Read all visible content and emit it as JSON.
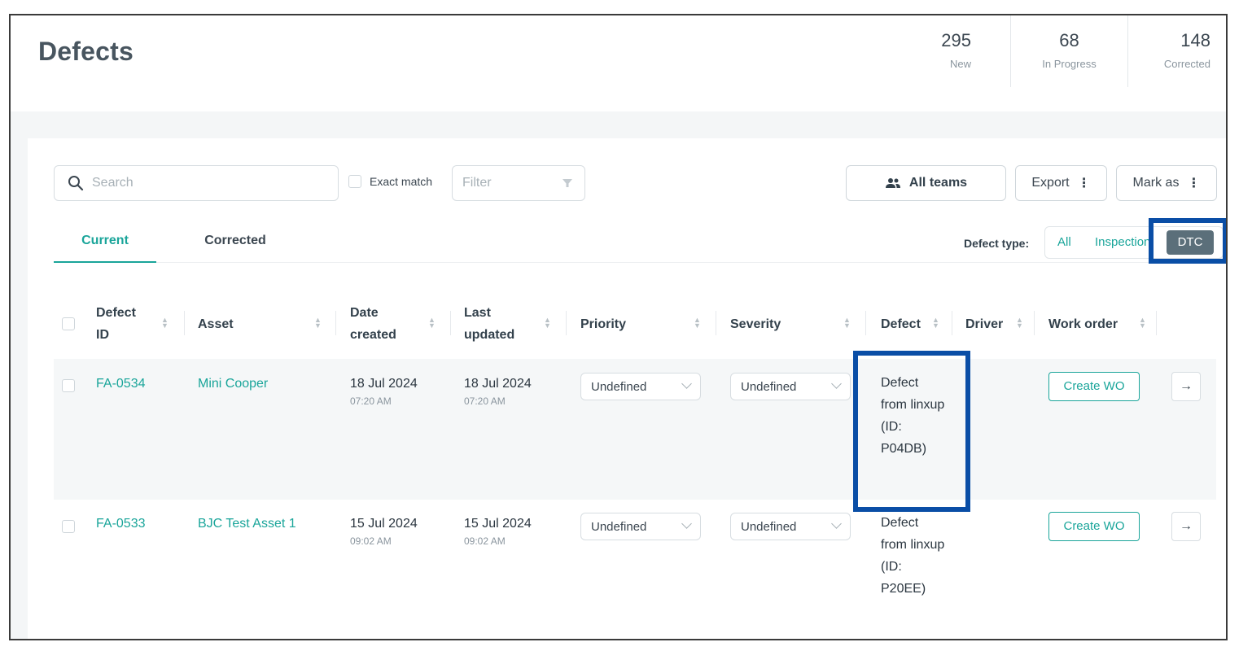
{
  "header": {
    "title": "Defects",
    "stats": [
      {
        "value": "295",
        "label": "New"
      },
      {
        "value": "68",
        "label": "In Progress"
      },
      {
        "value": "148",
        "label": "Corrected"
      }
    ]
  },
  "toolbar": {
    "search_placeholder": "Search",
    "exact_match_label": "Exact match",
    "filter_placeholder": "Filter",
    "teams_label": "All teams",
    "export_label": "Export",
    "mark_as_label": "Mark as",
    "kebab": "⋮"
  },
  "tabs": [
    {
      "label": "Current",
      "active": true
    },
    {
      "label": "Corrected",
      "active": false
    }
  ],
  "defect_type": {
    "label": "Defect type:",
    "options": [
      "All",
      "Inspection",
      "DTC"
    ],
    "selected": "DTC"
  },
  "table": {
    "columns": [
      "Defect ID",
      "Asset",
      "Date created",
      "Last updated",
      "Priority",
      "Severity",
      "Defect",
      "Driver",
      "Work order"
    ],
    "rows": [
      {
        "defect_id": "FA-0534",
        "asset": "Mini Cooper",
        "date_created": "18 Jul 2024",
        "date_created_time": "07:20 AM",
        "last_updated": "18 Jul 2024",
        "last_updated_time": "07:20 AM",
        "priority": "Undefined",
        "severity": "Undefined",
        "defect": "Defect from linxup (ID: P04DB)",
        "driver": "",
        "work_order": "Create WO",
        "open_icon": "→"
      },
      {
        "defect_id": "FA-0533",
        "asset": "BJC Test Asset 1",
        "date_created": "15 Jul 2024",
        "date_created_time": "09:02 AM",
        "last_updated": "15 Jul 2024",
        "last_updated_time": "09:02 AM",
        "priority": "Undefined",
        "severity": "Undefined",
        "defect": "Defect from linxup (ID: P20EE)",
        "driver": "",
        "work_order": "Create WO",
        "open_icon": "→"
      }
    ]
  },
  "colors": {
    "accent": "#1aa59a",
    "highlight": "#0a4ea6",
    "segment_selected": "#5b6f7a"
  }
}
